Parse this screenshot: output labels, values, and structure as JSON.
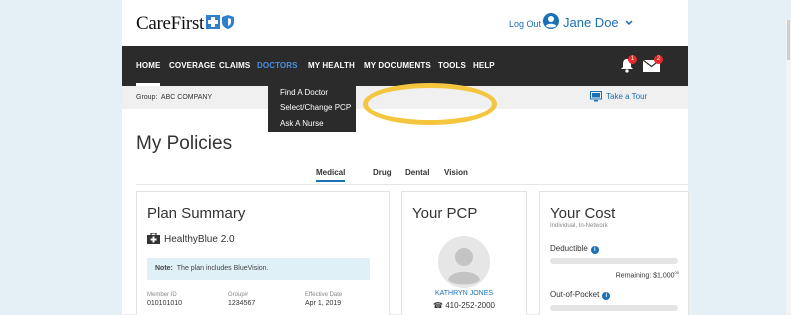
{
  "header": {
    "logo_text": "CareFirst",
    "logout_label": "Log Out",
    "user_name": "Jane Doe"
  },
  "nav": {
    "items": [
      "HOME",
      "COVERAGE",
      "CLAIMS",
      "DOCTORS",
      "MY HEALTH",
      "MY DOCUMENTS",
      "TOOLS",
      "HELP"
    ],
    "active": "DOCTORS",
    "notifications_count": "1",
    "messages_count": "2"
  },
  "dropdown": {
    "items": [
      "Find A Doctor",
      "Select/Change PCP",
      "Ask A Nurse"
    ]
  },
  "group": {
    "label": "Group:",
    "value": "ABC COMPANY",
    "tour_label": "Take a Tour"
  },
  "main": {
    "title": "My Policies",
    "tabs": [
      "Medical",
      "Drug",
      "Dental",
      "Vision"
    ],
    "active_tab": "Medical"
  },
  "plan": {
    "title": "Plan Summary",
    "name": "HealthyBlue 2.0",
    "note_label": "Note:",
    "note_text": "The plan includes BlueVision.",
    "member_id_label": "Member ID",
    "member_id": "010101010",
    "group_label": "Group#",
    "group_number": "1234567",
    "effective_label": "Effective Date",
    "effective_date": "Apr 1, 2019"
  },
  "pcp": {
    "title": "Your PCP",
    "name": "KATHRYN JONES",
    "phone": "410-252-2000"
  },
  "cost": {
    "title": "Your Cost",
    "subtitle": "Individual, In-Network",
    "deductible_label": "Deductible",
    "remaining_label": "Remaining:",
    "remaining_value": "$1,000",
    "remaining_cents": "00",
    "oop_label": "Out-of-Pocket"
  },
  "colors": {
    "accent": "#1a6fb5",
    "nav_bg": "#2b2b2b",
    "highlight": "#f3c63e",
    "badge": "#e22b2b"
  }
}
